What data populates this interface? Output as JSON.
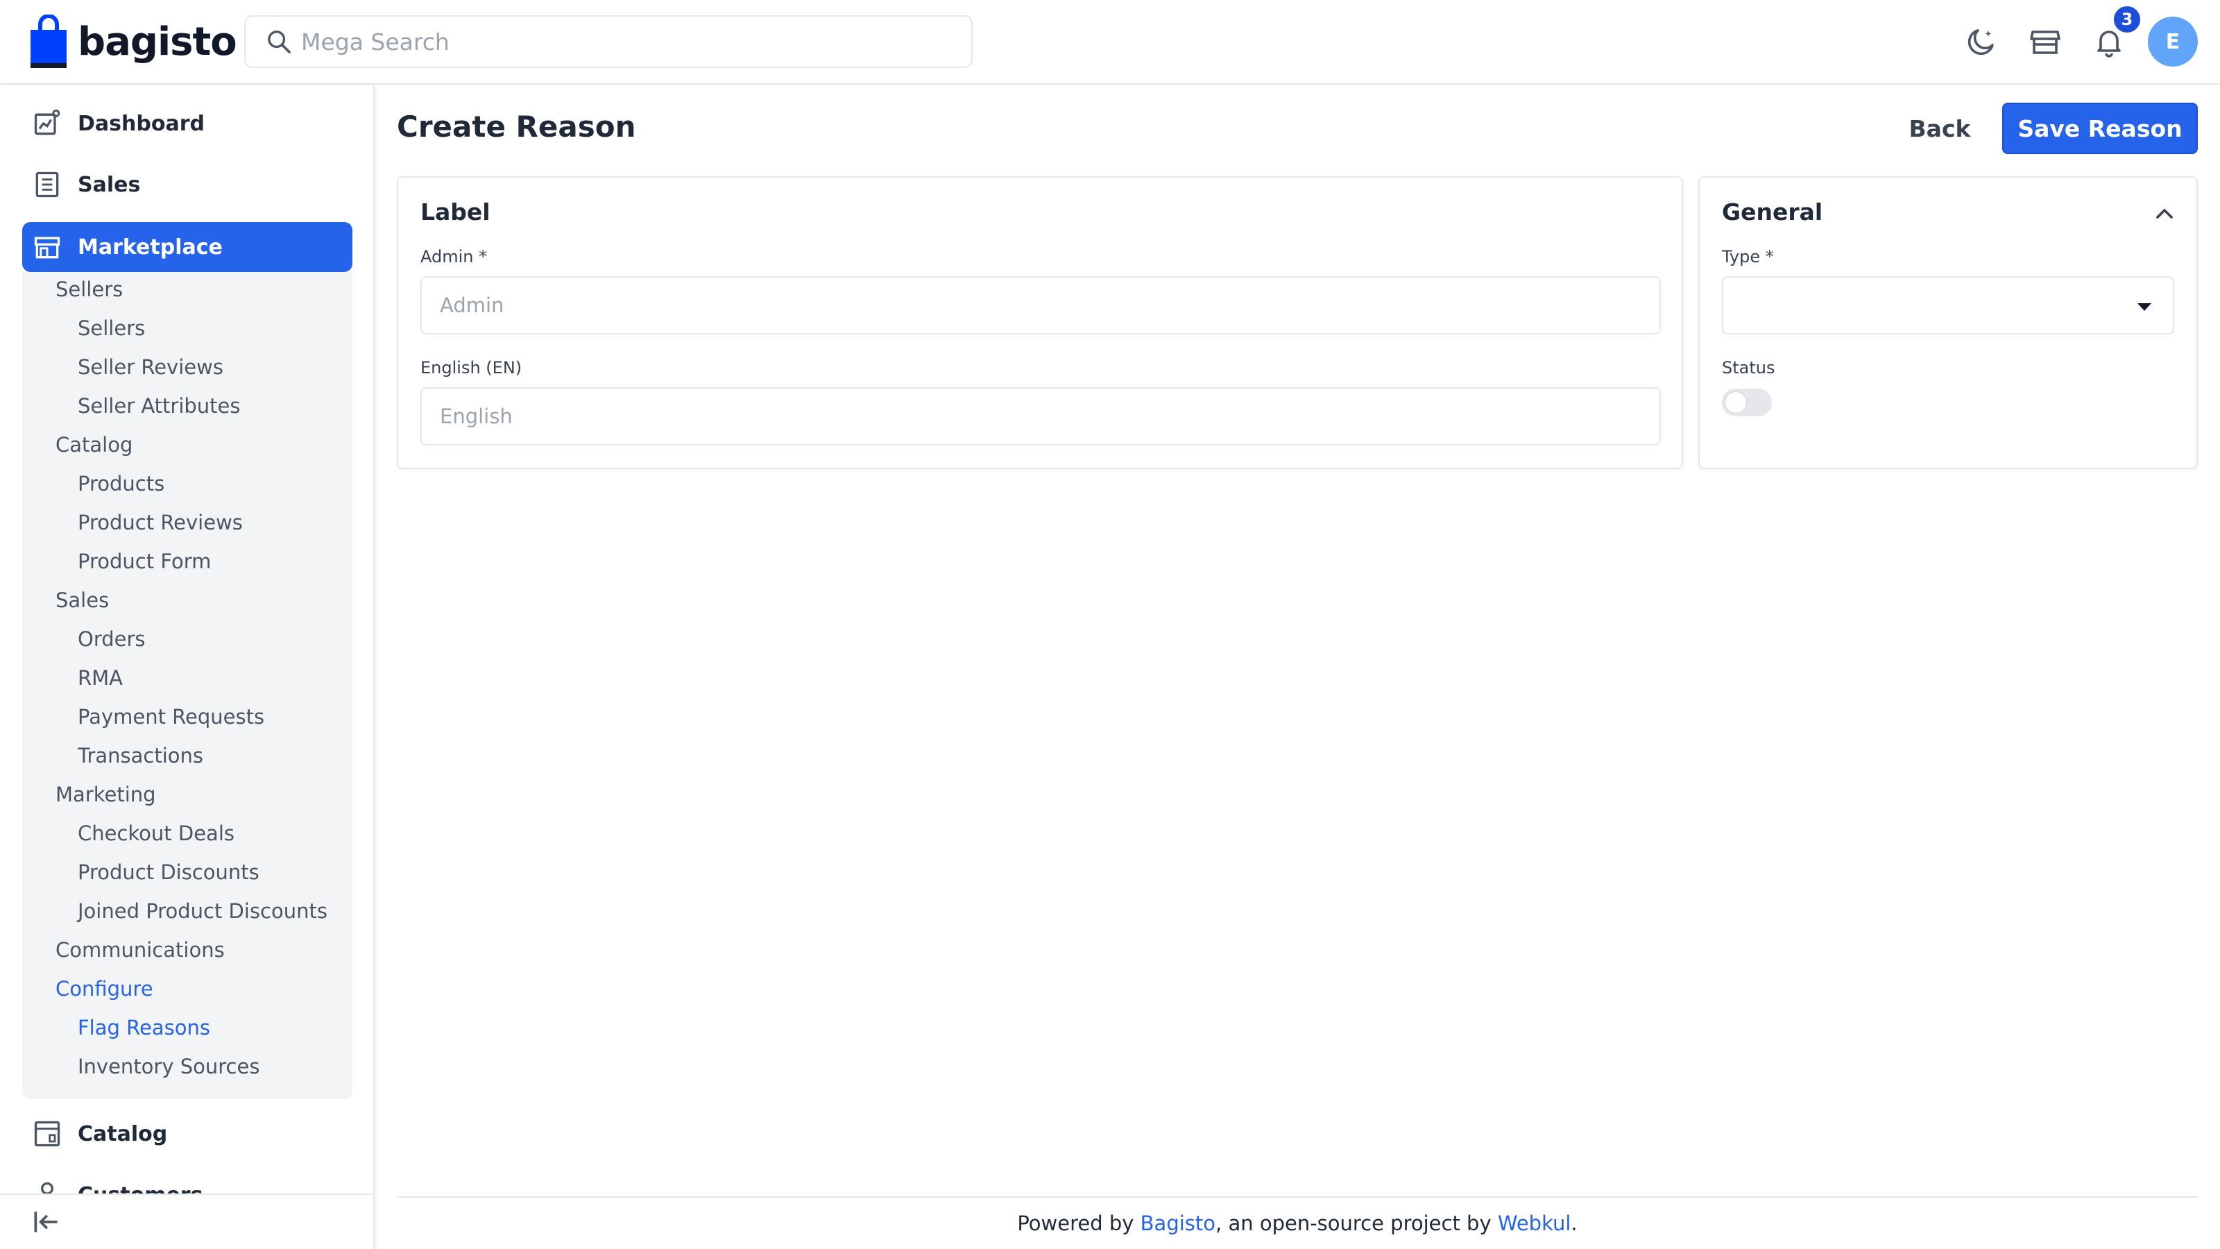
{
  "brand": {
    "name": "bagisto",
    "color": "#0041ff"
  },
  "search": {
    "placeholder": "Mega Search"
  },
  "header": {
    "notification_count": "3",
    "avatar_initial": "E",
    "icons": [
      "dark-mode-icon",
      "storefront-icon",
      "bell-icon"
    ]
  },
  "sidebar": {
    "top_items": [
      {
        "label": "Dashboard",
        "icon": "dashboard-icon"
      },
      {
        "label": "Sales",
        "icon": "receipt-icon"
      },
      {
        "label": "Marketplace",
        "icon": "store-icon",
        "active": true
      }
    ],
    "marketplace_menu": [
      {
        "label": "Sellers",
        "level": 1
      },
      {
        "label": "Sellers",
        "level": 2
      },
      {
        "label": "Seller Reviews",
        "level": 2
      },
      {
        "label": "Seller Attributes",
        "level": 2
      },
      {
        "label": "Catalog",
        "level": 1
      },
      {
        "label": "Products",
        "level": 2
      },
      {
        "label": "Product Reviews",
        "level": 2
      },
      {
        "label": "Product Form",
        "level": 2
      },
      {
        "label": "Sales",
        "level": 1
      },
      {
        "label": "Orders",
        "level": 2
      },
      {
        "label": "RMA",
        "level": 2
      },
      {
        "label": "Payment Requests",
        "level": 2
      },
      {
        "label": "Transactions",
        "level": 2
      },
      {
        "label": "Marketing",
        "level": 1
      },
      {
        "label": "Checkout Deals",
        "level": 2
      },
      {
        "label": "Product Discounts",
        "level": 2
      },
      {
        "label": "Joined Product Discounts",
        "level": 2
      },
      {
        "label": "Communications",
        "level": 1
      },
      {
        "label": "Configure",
        "level": 1,
        "active": true
      },
      {
        "label": "Flag Reasons",
        "level": 2,
        "active": true
      },
      {
        "label": "Inventory Sources",
        "level": 2
      }
    ],
    "bottom_items": [
      {
        "label": "Catalog",
        "icon": "catalog-icon"
      },
      {
        "label": "Customers",
        "icon": "customer-icon"
      }
    ]
  },
  "page": {
    "title": "Create Reason",
    "back_label": "Back",
    "save_label": "Save Reason"
  },
  "label_card": {
    "title": "Label",
    "admin_label": "Admin *",
    "admin_placeholder": "Admin",
    "admin_value": "",
    "english_label": "English (EN)",
    "english_placeholder": "English",
    "english_value": ""
  },
  "general_card": {
    "title": "General",
    "type_label": "Type *",
    "type_value": "",
    "status_label": "Status",
    "status_on": false
  },
  "footer": {
    "prefix": "Powered by ",
    "bagisto_link": "Bagisto",
    "middle": ", an open-source project by ",
    "webkul_link": "Webkul",
    "suffix": "."
  },
  "colors": {
    "accent": "#2563eb",
    "sidebar_submenu_bg": "#f3f4f6",
    "border": "#e5e7eb"
  }
}
